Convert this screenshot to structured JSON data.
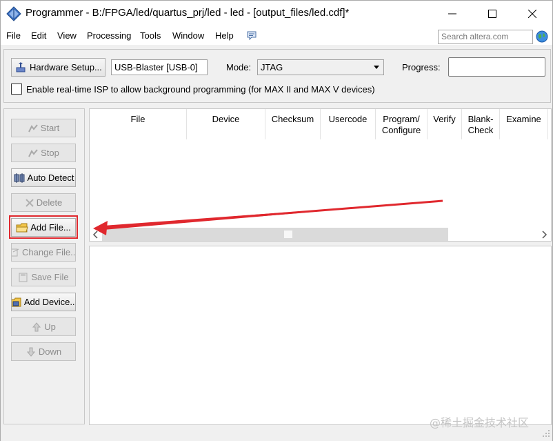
{
  "window": {
    "title": "Programmer - B:/FPGA/led/quartus_prj/led - led - [output_files/led.cdf]*"
  },
  "menu": {
    "items": [
      {
        "label": "File"
      },
      {
        "label": "Edit"
      },
      {
        "label": "View"
      },
      {
        "label": "Processing"
      },
      {
        "label": "Tools"
      },
      {
        "label": "Window"
      },
      {
        "label": "Help"
      }
    ],
    "search_placeholder": "Search altera.com"
  },
  "toolbar": {
    "hardware_setup_label": "Hardware Setup...",
    "hardware_value": "USB-Blaster [USB-0]",
    "mode_label": "Mode:",
    "mode_value": "JTAG",
    "progress_label": "Progress:",
    "isp_label": "Enable real-time ISP to allow background programming (for MAX II and MAX V devices)",
    "isp_checked": false
  },
  "side_buttons": [
    {
      "label": "Start",
      "enabled": false,
      "icon": "start-icon"
    },
    {
      "label": "Stop",
      "enabled": false,
      "icon": "stop-icon"
    },
    {
      "label": "Auto Detect",
      "enabled": true,
      "icon": "auto-detect-icon"
    },
    {
      "label": "Delete",
      "enabled": false,
      "icon": "delete-icon"
    },
    {
      "label": "Add File...",
      "enabled": true,
      "icon": "folder-icon"
    },
    {
      "label": "Change File...",
      "enabled": false,
      "icon": "change-file-icon"
    },
    {
      "label": "Save File",
      "enabled": false,
      "icon": "save-file-icon"
    },
    {
      "label": "Add Device...",
      "enabled": true,
      "icon": "add-device-icon"
    },
    {
      "label": "Up",
      "enabled": false,
      "icon": "up-icon"
    },
    {
      "label": "Down",
      "enabled": false,
      "icon": "down-icon"
    }
  ],
  "table": {
    "columns": [
      {
        "label": "File"
      },
      {
        "label": "Device"
      },
      {
        "label": "Checksum"
      },
      {
        "label": "Usercode"
      },
      {
        "label": "Program/\nConfigure"
      },
      {
        "label": "Verify"
      },
      {
        "label": "Blank-\nCheck"
      },
      {
        "label": "Examine"
      }
    ],
    "rows": []
  },
  "watermark": "@稀土掘金技术社区",
  "colors": {
    "highlight": "#e0282e",
    "window_bg": "#f0f0f0"
  }
}
